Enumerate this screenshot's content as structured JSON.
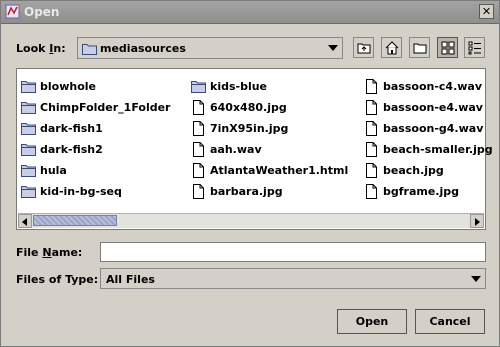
{
  "window": {
    "title": "Open"
  },
  "look_in": {
    "label_pre": "Look ",
    "label_key": "I",
    "label_post": "n:",
    "value": "mediasources"
  },
  "toolbar": {
    "icons": [
      "up-folder-icon",
      "home-icon",
      "new-folder-icon",
      "list-view-icon",
      "details-view-icon"
    ]
  },
  "files": [
    {
      "name": "blowhole",
      "kind": "folder"
    },
    {
      "name": "ChimpFolder_1Folder",
      "kind": "folder"
    },
    {
      "name": "dark-fish1",
      "kind": "folder"
    },
    {
      "name": "dark-fish2",
      "kind": "folder"
    },
    {
      "name": "hula",
      "kind": "folder"
    },
    {
      "name": "kid-in-bg-seq",
      "kind": "folder"
    },
    {
      "name": "kids-blue",
      "kind": "folder"
    },
    {
      "name": "640x480.jpg",
      "kind": "file"
    },
    {
      "name": "7inX95in.jpg",
      "kind": "file"
    },
    {
      "name": "aah.wav",
      "kind": "file"
    },
    {
      "name": "AtlantaWeather1.html",
      "kind": "file"
    },
    {
      "name": "barbara.jpg",
      "kind": "file"
    },
    {
      "name": "bassoon-c4.wav",
      "kind": "file"
    },
    {
      "name": "bassoon-e4.wav",
      "kind": "file"
    },
    {
      "name": "bassoon-g4.wav",
      "kind": "file"
    },
    {
      "name": "beach-smaller.jpg",
      "kind": "file"
    },
    {
      "name": "beach.jpg",
      "kind": "file"
    },
    {
      "name": "bgframe.jpg",
      "kind": "file"
    }
  ],
  "file_name": {
    "label_pre": "File ",
    "label_key": "N",
    "label_post": "ame:",
    "value": ""
  },
  "file_type": {
    "label": "Files of Type:",
    "value": "All Files"
  },
  "buttons": {
    "open": "Open",
    "cancel": "Cancel"
  }
}
